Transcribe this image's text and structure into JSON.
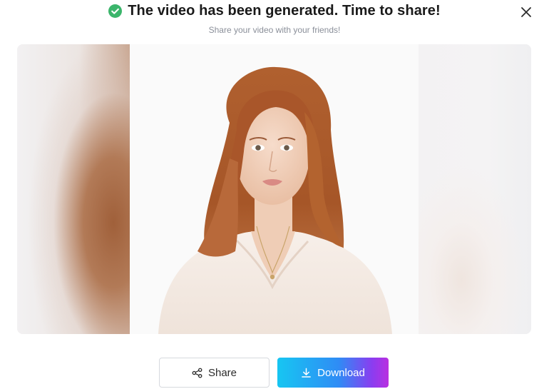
{
  "dialog": {
    "title": "The video has been generated. Time to share!",
    "subtitle": "Share your video with your friends!",
    "title_icon": "check-circle-icon",
    "close_icon": "close-icon"
  },
  "preview": {
    "alt": "Generated video preview"
  },
  "actions": {
    "share_label": "Share",
    "share_icon": "share-icon",
    "download_label": "Download",
    "download_icon": "download-icon"
  },
  "colors": {
    "success": "#3bb56b",
    "download_gradient_start": "#17c6f2",
    "download_gradient_end": "#b92fe0",
    "title_text": "#1a1a1a",
    "subtitle_text": "#8a8f99"
  }
}
